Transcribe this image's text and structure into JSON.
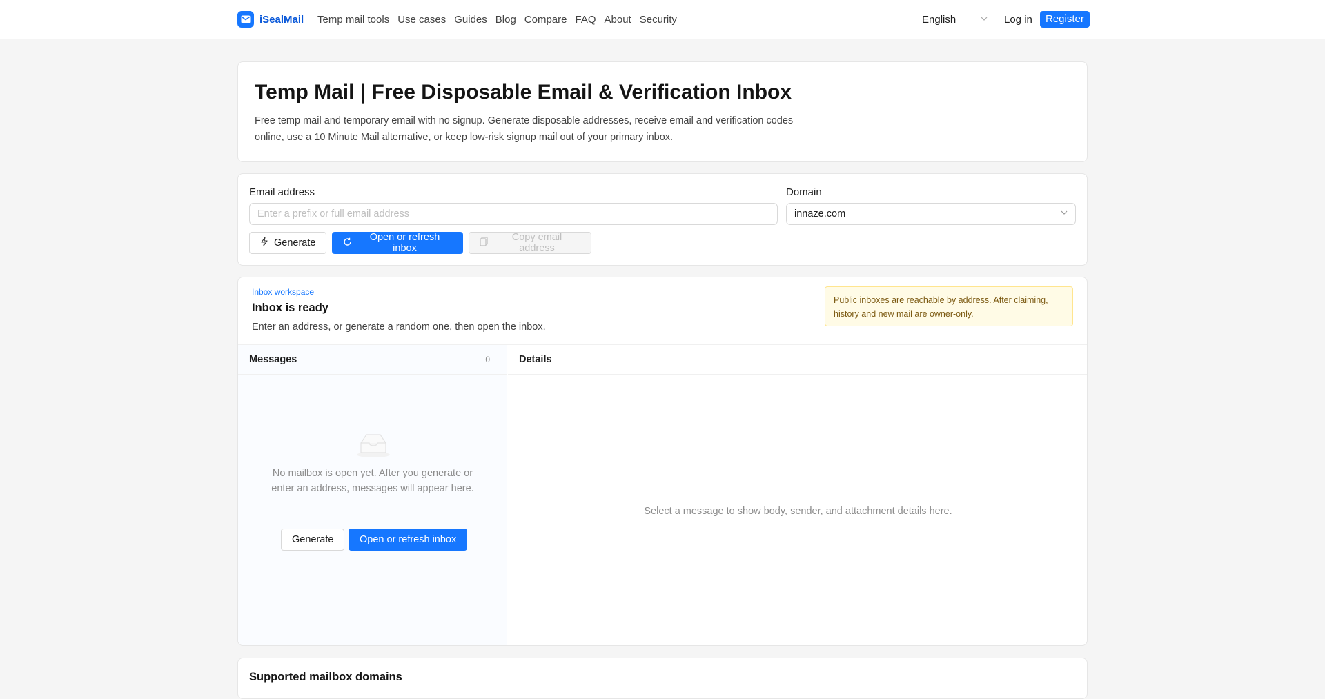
{
  "header": {
    "brand": "iSealMail",
    "nav": [
      "Temp mail tools",
      "Use cases",
      "Guides",
      "Blog",
      "Compare",
      "FAQ",
      "About",
      "Security"
    ],
    "language": "English",
    "login": "Log in",
    "register": "Register"
  },
  "hero": {
    "title": "Temp Mail | Free Disposable Email & Verification Inbox",
    "description": "Free temp mail and temporary email with no signup. Generate disposable addresses, receive email and verification codes online, use a 10 Minute Mail alternative, or keep low-risk signup mail out of your primary inbox."
  },
  "form": {
    "email_label": "Email address",
    "email_placeholder": "Enter a prefix or full email address",
    "email_value": "",
    "domain_label": "Domain",
    "domain_value": "innaze.com",
    "generate": "Generate",
    "open_refresh": "Open or refresh inbox",
    "copy": "Copy email address"
  },
  "workspace": {
    "eyebrow": "Inbox workspace",
    "title": "Inbox is ready",
    "subtitle": "Enter an address, or generate a random one, then open the inbox.",
    "notice": "Public inboxes are reachable by address. After claiming, history and new mail are owner-only.",
    "messages_title": "Messages",
    "messages_count": "0",
    "empty_text": "No mailbox is open yet. After you generate or enter an address, messages will appear here.",
    "generate": "Generate",
    "open_refresh": "Open or refresh inbox",
    "details_title": "Details",
    "details_hint": "Select a message to show body, sender, and attachment details here."
  },
  "domains": {
    "title": "Supported mailbox domains"
  },
  "colors": {
    "primary": "#1677ff",
    "brand_text": "#0958d9",
    "notice_bg": "#fffbe6",
    "page_bg": "#f5f5f5"
  }
}
